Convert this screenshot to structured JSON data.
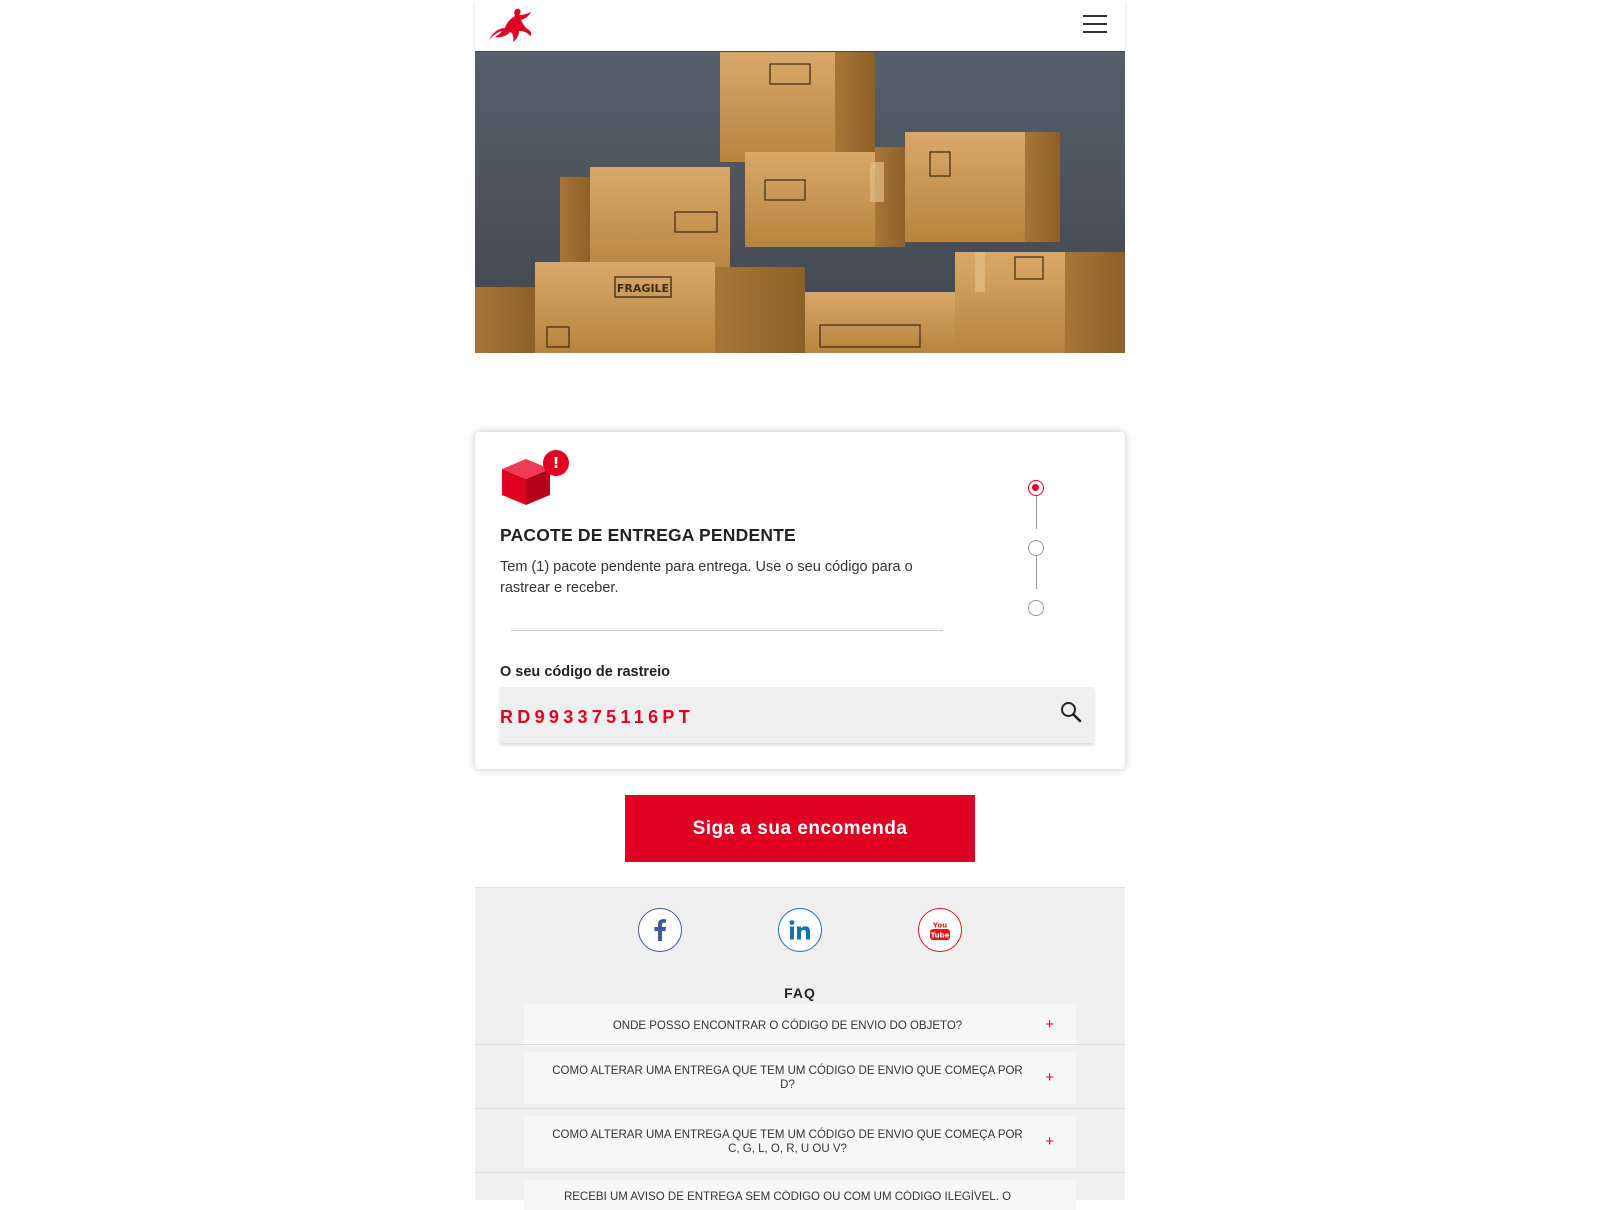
{
  "colors": {
    "accent": "#df0024",
    "facebook": "#3b5998",
    "linkedin": "#0e76a8",
    "youtube": "#e4141a"
  },
  "header": {
    "logo_icon": "horse-rider-logo-icon",
    "menu_icon": "hamburger-menu-icon"
  },
  "hero": {
    "image": "cardboard-boxes-photo",
    "box_label": "FRAGILE"
  },
  "card": {
    "icon": "package-alert-icon",
    "badge": "!",
    "title": "PACOTE DE ENTREGA PENDENTE",
    "text": "Tem (1) pacote pendente para entrega. Use o seu código para o rastrear e receber.",
    "steps_total": 3,
    "steps_active": 1,
    "field_label": "O seu código de rastreio",
    "tracking_code": "RD993375116PT",
    "search_icon": "search-icon"
  },
  "cta": {
    "label": "Siga a sua encomenda"
  },
  "social": [
    {
      "name": "facebook",
      "icon": "facebook-icon"
    },
    {
      "name": "linkedin",
      "icon": "linkedin-icon"
    },
    {
      "name": "youtube",
      "icon": "youtube-icon"
    }
  ],
  "faq": {
    "title": "FAQ",
    "items": [
      {
        "question": "ONDE POSSO ENCONTRAR O CÓDIGO DE ENVIO DO OBJETO?",
        "toggle": "+"
      },
      {
        "question": "COMO ALTERAR UMA ENTREGA QUE TEM UM CÓDIGO DE ENVIO QUE COMEÇA POR D?",
        "toggle": "+"
      },
      {
        "question": "COMO ALTERAR UMA ENTREGA QUE TEM UM CÓDIGO DE ENVIO QUE COMEÇA POR C, G, L, O, R, U OU V?",
        "toggle": "+"
      },
      {
        "question": "RECEBI UM AVISO DE ENTREGA SEM CÓDIGO OU COM UM CÓDIGO ILEGÍVEL. O",
        "toggle": ""
      }
    ]
  }
}
